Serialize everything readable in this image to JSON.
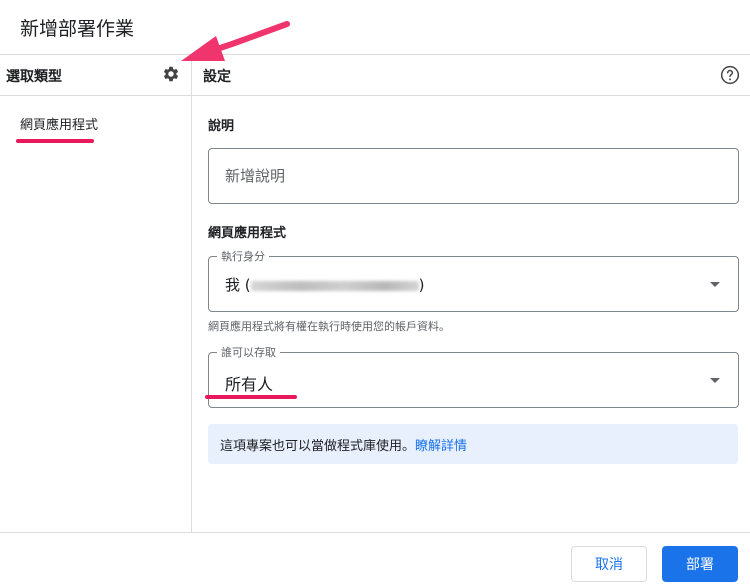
{
  "dialog": {
    "title": "新增部署作業"
  },
  "left_panel": {
    "header": "選取類型",
    "items": [
      {
        "label": "網頁應用程式"
      }
    ]
  },
  "right_panel": {
    "header": "設定",
    "description": {
      "section_label": "說明",
      "placeholder": "新增說明"
    },
    "web_app": {
      "section_label": "網頁應用程式",
      "execute_as": {
        "legend": "執行身分",
        "value_prefix": "我 (",
        "value_suffix": ")"
      },
      "helper_text": "網頁應用程式將有權在執行時使用您的帳戶資料。",
      "who_has_access": {
        "legend": "誰可以存取",
        "value": "所有人"
      }
    },
    "info": {
      "text": "這項專案也可以當做程式庫使用。",
      "link": "瞭解詳情"
    }
  },
  "footer": {
    "cancel_label": "取消",
    "deploy_label": "部署"
  },
  "colors": {
    "accent": "#1a73e8",
    "annotation": "#e8185d",
    "info_bg": "#e8f0fe"
  },
  "icons": {
    "settings": "gear-icon",
    "help": "help-circle-icon",
    "dropdown": "caret-down-icon"
  }
}
